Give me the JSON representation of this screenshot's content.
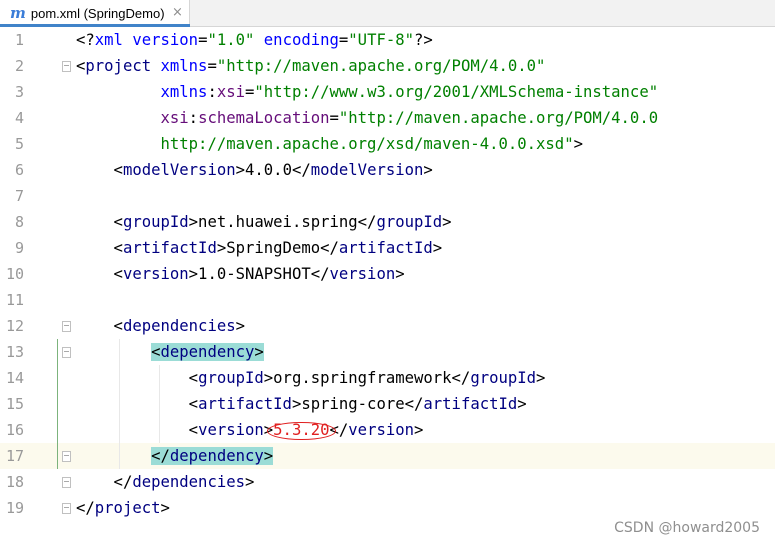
{
  "tab": {
    "icon": "maven-m-icon",
    "icon_glyph": "m",
    "title": "pom.xml (SpringDemo)",
    "close_glyph": "×"
  },
  "editor": {
    "current_line": 17,
    "lines": [
      {
        "n": "1",
        "segs": [
          [
            "t",
            "<?"
          ],
          [
            "a",
            "xml"
          ],
          [
            "t",
            " "
          ],
          [
            "a",
            "version"
          ],
          [
            "t",
            "="
          ],
          [
            "v",
            "\"1.0\""
          ],
          [
            "t",
            " "
          ],
          [
            "a",
            "encoding"
          ],
          [
            "t",
            "="
          ],
          [
            "v",
            "\"UTF-8\""
          ],
          [
            "t",
            "?>"
          ]
        ]
      },
      {
        "n": "2",
        "segs": [
          [
            "t",
            "<"
          ],
          [
            "g",
            "project"
          ],
          [
            "t",
            " "
          ],
          [
            "a",
            "xmlns"
          ],
          [
            "t",
            "="
          ],
          [
            "v",
            "\"http://maven.apache.org/POM/4.0.0\""
          ]
        ]
      },
      {
        "n": "3",
        "segs": [
          [
            "t",
            "         "
          ],
          [
            "a",
            "xmlns"
          ],
          [
            "t",
            ":"
          ],
          [
            "n",
            "xsi"
          ],
          [
            "t",
            "="
          ],
          [
            "v",
            "\"http://www.w3.org/2001/XMLSchema-instance\""
          ]
        ]
      },
      {
        "n": "4",
        "segs": [
          [
            "t",
            "         "
          ],
          [
            "n",
            "xsi"
          ],
          [
            "t",
            ":"
          ],
          [
            "n",
            "schemaLocation"
          ],
          [
            "t",
            "="
          ],
          [
            "v",
            "\"http://maven.apache.org/POM/4.0.0"
          ]
        ]
      },
      {
        "n": "5",
        "segs": [
          [
            "t",
            "         "
          ],
          [
            "v",
            "http://maven.apache.org/xsd/maven-4.0.0.xsd\""
          ],
          [
            "t",
            ">"
          ]
        ]
      },
      {
        "n": "6",
        "segs": [
          [
            "t",
            "    <"
          ],
          [
            "g",
            "modelVersion"
          ],
          [
            "t",
            ">4.0.0</"
          ],
          [
            "g",
            "modelVersion"
          ],
          [
            "t",
            ">"
          ]
        ]
      },
      {
        "n": "7",
        "segs": []
      },
      {
        "n": "8",
        "segs": [
          [
            "t",
            "    <"
          ],
          [
            "g",
            "groupId"
          ],
          [
            "t",
            ">net.huawei.spring</"
          ],
          [
            "g",
            "groupId"
          ],
          [
            "t",
            ">"
          ]
        ]
      },
      {
        "n": "9",
        "segs": [
          [
            "t",
            "    <"
          ],
          [
            "g",
            "artifactId"
          ],
          [
            "t",
            ">SpringDemo</"
          ],
          [
            "g",
            "artifactId"
          ],
          [
            "t",
            ">"
          ]
        ]
      },
      {
        "n": "10",
        "segs": [
          [
            "t",
            "    <"
          ],
          [
            "g",
            "version"
          ],
          [
            "t",
            ">1.0-SNAPSHOT</"
          ],
          [
            "g",
            "version"
          ],
          [
            "t",
            ">"
          ]
        ]
      },
      {
        "n": "11",
        "segs": []
      },
      {
        "n": "12",
        "segs": [
          [
            "t",
            "    <"
          ],
          [
            "g",
            "dependencies"
          ],
          [
            "t",
            ">"
          ]
        ]
      },
      {
        "n": "13",
        "segs": [
          [
            "t",
            "        "
          ],
          [
            "h",
            "<"
          ],
          [
            "hg",
            "dependency"
          ],
          [
            "h",
            ">"
          ]
        ]
      },
      {
        "n": "14",
        "segs": [
          [
            "t",
            "            <"
          ],
          [
            "g",
            "groupId"
          ],
          [
            "t",
            ">org.springframework</"
          ],
          [
            "g",
            "groupId"
          ],
          [
            "t",
            ">"
          ]
        ]
      },
      {
        "n": "15",
        "segs": [
          [
            "t",
            "            <"
          ],
          [
            "g",
            "artifactId"
          ],
          [
            "t",
            ">spring-core</"
          ],
          [
            "g",
            "artifactId"
          ],
          [
            "t",
            ">"
          ]
        ]
      },
      {
        "n": "16",
        "segs": [
          [
            "t",
            "            <"
          ],
          [
            "g",
            "version"
          ],
          [
            "t",
            ">"
          ],
          [
            "r",
            "5.3.20"
          ],
          [
            "t",
            "</"
          ],
          [
            "g",
            "version"
          ],
          [
            "t",
            ">"
          ]
        ]
      },
      {
        "n": "17",
        "segs": [
          [
            "t",
            "        "
          ],
          [
            "h",
            "</"
          ],
          [
            "hg",
            "dependency"
          ],
          [
            "h",
            ">"
          ]
        ]
      },
      {
        "n": "18",
        "segs": [
          [
            "t",
            "    </"
          ],
          [
            "g",
            "dependencies"
          ],
          [
            "t",
            ">"
          ]
        ]
      },
      {
        "n": "19",
        "segs": [
          [
            "t",
            "</"
          ],
          [
            "g",
            "project"
          ],
          [
            "t",
            ">"
          ]
        ]
      }
    ]
  },
  "colors": {
    "tag": "#000080",
    "attribute": "#0000ff",
    "value": "#008000",
    "namespace": "#660e7a",
    "highlight": "#9bdcd6",
    "annotation": "#e02020"
  },
  "watermark": "CSDN @howard2005"
}
